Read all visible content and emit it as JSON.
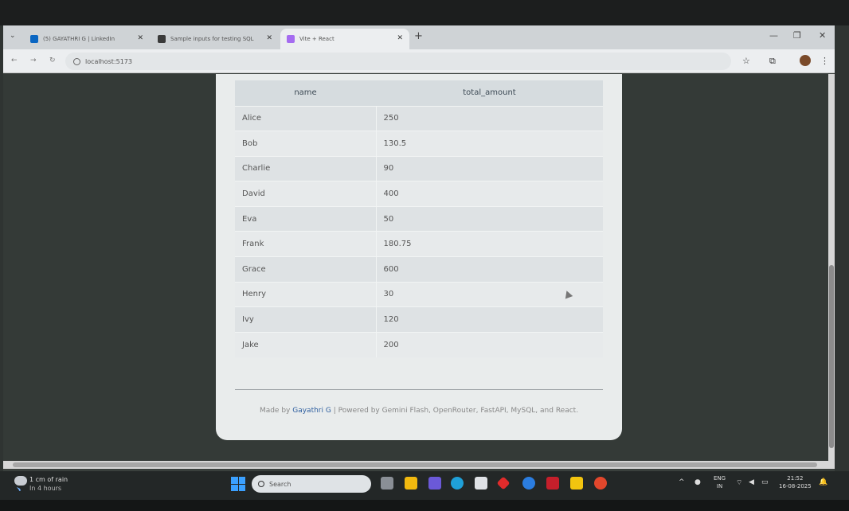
{
  "browser": {
    "tabs": [
      {
        "label": "(5) GAYATHRI G | LinkedIn",
        "active": false
      },
      {
        "label": "Sample inputs for testing SQL",
        "active": false
      },
      {
        "label": "Vite + React",
        "active": true
      }
    ],
    "address": "localhost:5173"
  },
  "results_table": {
    "headers": [
      "name",
      "total_amount"
    ],
    "rows": [
      [
        "Alice",
        "250"
      ],
      [
        "Bob",
        "130.5"
      ],
      [
        "Charlie",
        "90"
      ],
      [
        "David",
        "400"
      ],
      [
        "Eva",
        "50"
      ],
      [
        "Frank",
        "180.75"
      ],
      [
        "Grace",
        "600"
      ],
      [
        "Henry",
        "30"
      ],
      [
        "Ivy",
        "120"
      ],
      [
        "Jake",
        "200"
      ]
    ]
  },
  "footer": {
    "made_by": "Made by ",
    "author": "Gayathri G",
    "powered": " | Powered by Gemini Flash, OpenRouter, FastAPI, MySQL, and React."
  },
  "taskbar": {
    "weather_line1": "1 cm of rain",
    "weather_line2": "In 4 hours",
    "search_placeholder": "Search",
    "lang1": "ENG",
    "lang2": "IN",
    "time": "21:52",
    "date": "16-08-2025"
  },
  "colors": {
    "accent_link": "#2f5fa0",
    "card_bg": "#e9ecec",
    "desktop_bg": "#343a37"
  }
}
